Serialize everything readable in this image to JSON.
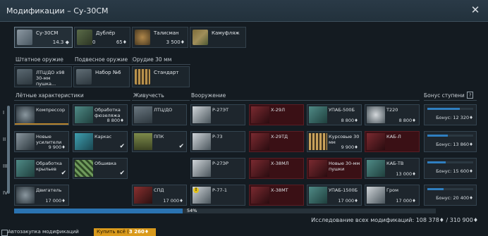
{
  "window": {
    "title": "Модификации – Су-30СМ",
    "close_icon": "close-icon"
  },
  "colors": {
    "accent_blue": "#2f7fc0",
    "red_tile": "#3a1015",
    "gold": "#d99a1c"
  },
  "top_slots": [
    {
      "name": "Су-30СМ",
      "value": "14.3 ◆",
      "icon": "jet-icon"
    },
    {
      "name": "Дублёр",
      "value": "65♦",
      "left_value": "0",
      "icon": "crew-icon"
    },
    {
      "name": "Талисман",
      "value": "3 500♦",
      "icon": "talisman-icon"
    },
    {
      "name": "Камуфляж",
      "value": "",
      "icon": "camo-icon"
    }
  ],
  "weapon_tabs": {
    "standard": "Штатное оружие",
    "suspended": "Подвесное оружие",
    "guns": "Орудие 30 мм"
  },
  "weapon_slots": {
    "standard": "ЛТЦ/ДО х98 30-мм пушка...",
    "suspended": "Набор №6",
    "guns": "Стандарт"
  },
  "columns": {
    "flight": "Лётные характеристики",
    "survivability": "Живучесть",
    "armament": "Вооружение",
    "bonus": "Бонус ступени",
    "help_icon": "?"
  },
  "tiers": [
    "I",
    "II",
    "III",
    "IV"
  ],
  "mods": {
    "r1": [
      {
        "name": "Компрессор",
        "price": "",
        "bar": true
      },
      {
        "name": "Обработка фюзеляжа",
        "price": "8 800♦"
      },
      {
        "name": "ЛТЦ/ДО",
        "price": ""
      },
      {
        "name": "Р-27ЭТ",
        "price": ""
      },
      {
        "name": "Х-29Л",
        "price": ""
      },
      {
        "name": "УПАБ-500Б",
        "price": "8 800♦"
      },
      {
        "name": "Т220",
        "price": "8 800♦"
      }
    ],
    "r2": [
      {
        "name": "Новые усилители",
        "price": "9 900♦"
      },
      {
        "name": "Каркас",
        "price": "",
        "check": true
      },
      {
        "name": "ППК",
        "price": "",
        "check": true
      },
      {
        "name": "Р-73",
        "price": ""
      },
      {
        "name": "Х-29ТД",
        "price": ""
      },
      {
        "name": "Курсовые 30 мм",
        "price": "9 900♦"
      },
      {
        "name": "КАБ-Л",
        "price": ""
      }
    ],
    "r3": [
      {
        "name": "Обработка крыльев",
        "price": "",
        "check": true
      },
      {
        "name": "Обшивка",
        "price": "",
        "check": true
      },
      {
        "name": "Р-27ЭР",
        "price": ""
      },
      {
        "name": "Х-38МЛ",
        "price": ""
      },
      {
        "name": "Новые 30-мм пушки",
        "price": ""
      },
      {
        "name": "КАБ-ТВ",
        "price": "13 000♦"
      }
    ],
    "r4": [
      {
        "name": "Двигатель",
        "price": "17 000♦"
      },
      {
        "name": "СПД",
        "price": "17 000♦"
      },
      {
        "name": "Р-77-1",
        "price": "",
        "warn": "!"
      },
      {
        "name": "Х-38МТ",
        "price": ""
      },
      {
        "name": "УПАБ-1500Б",
        "price": "17 000♦"
      },
      {
        "name": "Гром",
        "price": "17 000♦"
      }
    ]
  },
  "bonus": [
    {
      "label": "Бонус: 12 320♦",
      "fill": 0.7
    },
    {
      "label": "Бонус: 13 860♦",
      "fill": 0.45
    },
    {
      "label": "Бонус: 15 600♦",
      "fill": 0.4
    },
    {
      "label": "Бонус: 20 400♦",
      "fill": 0.35
    }
  ],
  "progress": {
    "percent": "54%",
    "fraction": 0.4
  },
  "research_text": "Исследование всех модификаций: 108 378♦ / 310 900♦",
  "bottom": {
    "auto_buy": "Автозакупка модификаций",
    "buy_all": "Купить всё (",
    "buy_num": "3 260♦"
  }
}
